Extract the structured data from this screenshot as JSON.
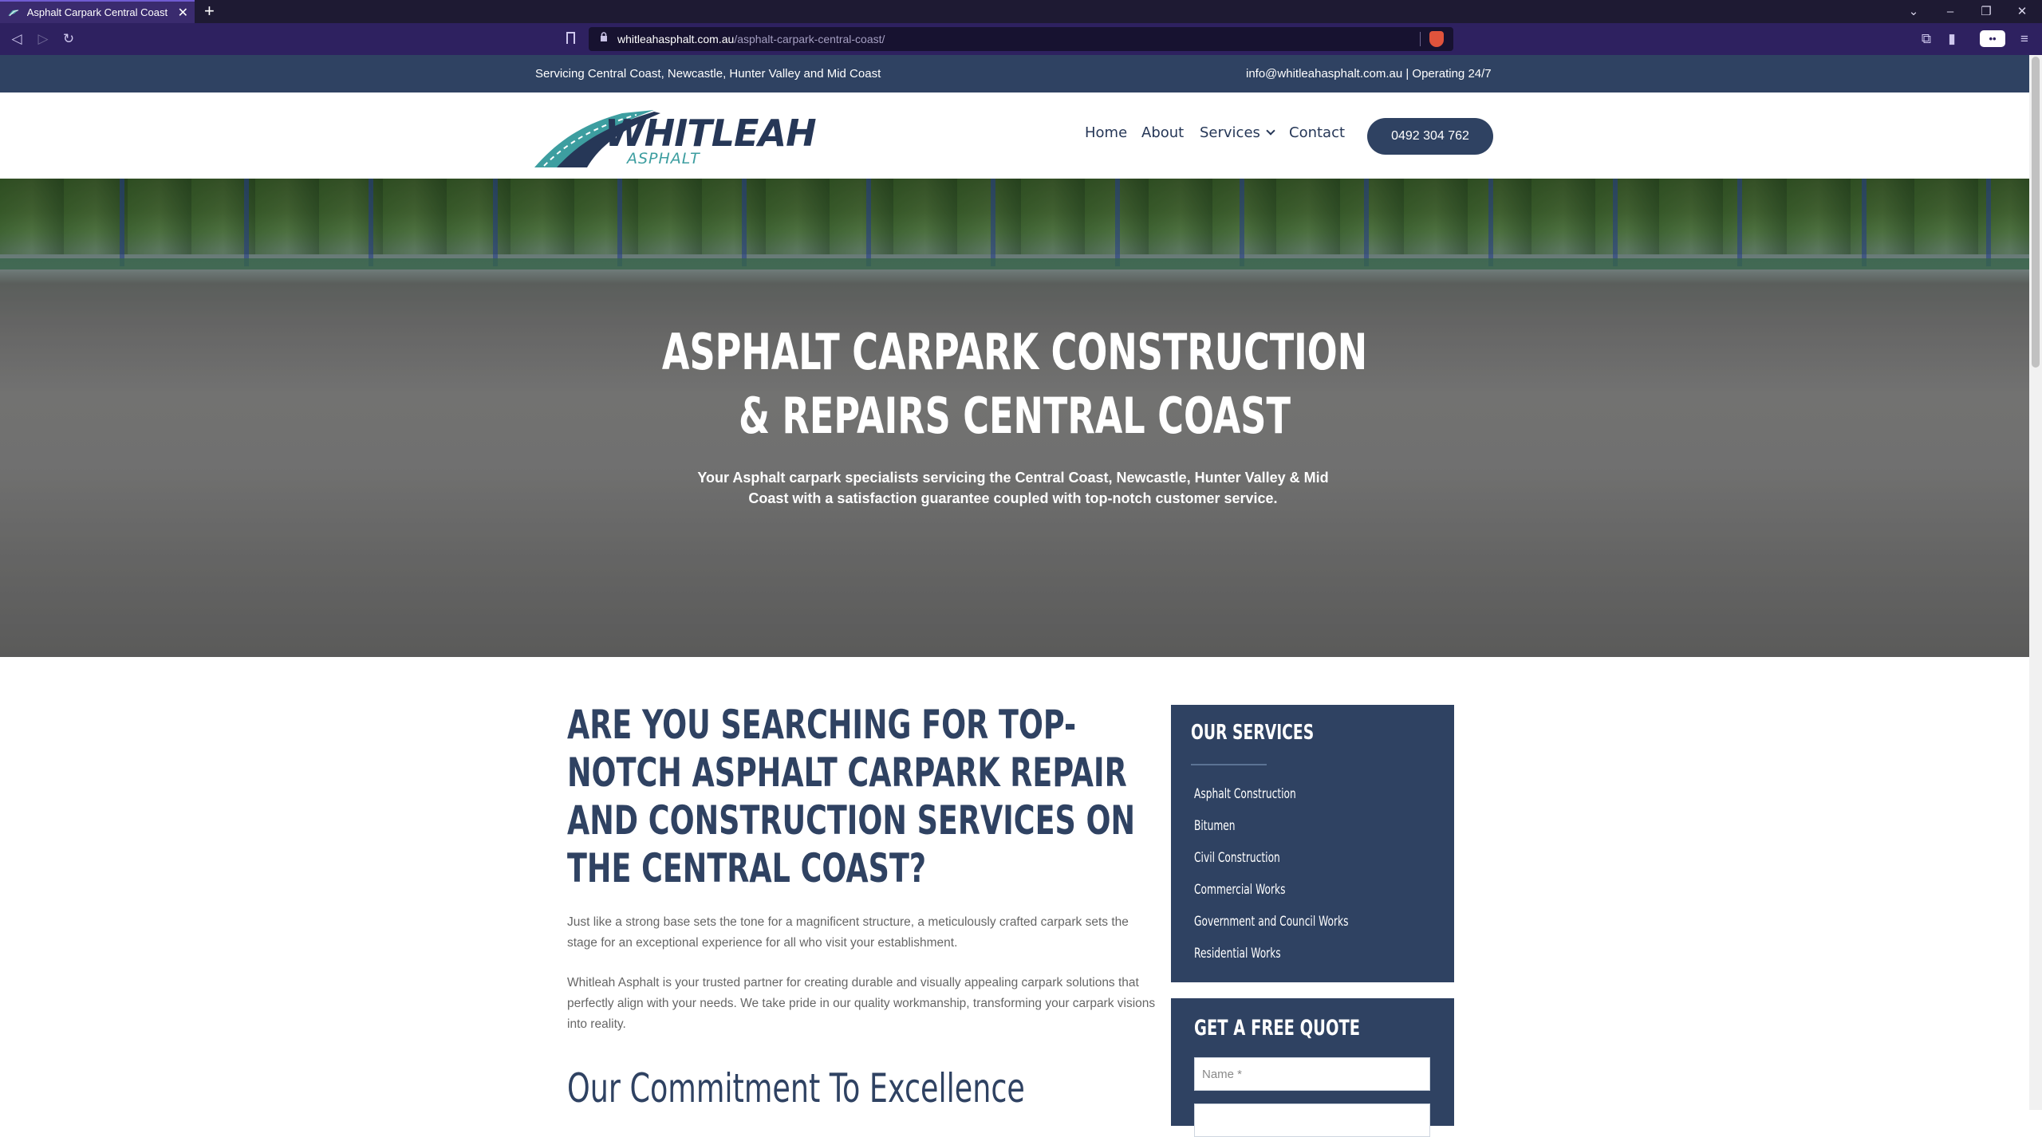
{
  "browser": {
    "tab_title": "Asphalt Carpark Central Coast - W",
    "new_tab": "+",
    "tab_close": "✕",
    "url_host": "whitleahasphalt.com.au",
    "url_path": "/asphalt-carpark-central-coast/",
    "back": "◁",
    "forward": "▷",
    "reload": "↻",
    "lock_icon": "🔒",
    "window_controls": {
      "list": "⌄",
      "minimize": "–",
      "restore": "❐",
      "close": "✕"
    },
    "menu_icon": "≡"
  },
  "topbar": {
    "left": "Servicing Central Coast, Newcastle, Hunter Valley and Mid Coast",
    "right": "info@whitleahasphalt.com.au | Operating 24/7"
  },
  "logo": {
    "word": "WHITLEAH",
    "sub": "ASPHALT"
  },
  "nav": {
    "home": "Home",
    "about": "About",
    "services": "Services",
    "contact": "Contact",
    "phone": "0492 304 762"
  },
  "hero": {
    "title_line1": "ASPHALT CARPARK CONSTRUCTION",
    "title_line2": "& REPAIRS CENTRAL COAST",
    "subtitle": "Your Asphalt carpark specialists servicing the Central Coast, Newcastle, Hunter Valley & Mid Coast with a satisfaction guarantee coupled with top-notch customer service."
  },
  "main": {
    "heading": "ARE YOU SEARCHING FOR TOP-NOTCH ASPHALT CARPARK REPAIR AND CONSTRUCTION SERVICES ON THE CENTRAL COAST?",
    "para1": "Just like a strong base sets the tone for a magnificent structure, a meticulously crafted carpark sets the stage for an exceptional experience for all who visit your establishment.",
    "para2": "Whitleah Asphalt is your trusted partner for creating durable and visually appealing carpark solutions that perfectly align with your needs. We take pride in our quality workmanship, transforming your carpark visions into reality.",
    "subheading": "Our Commitment To Excellence"
  },
  "sidebar": {
    "services_title": "OUR SERVICES",
    "services": [
      "Asphalt Construction",
      "Bitumen",
      "Civil Construction",
      "Commercial Works",
      "Government and Council Works",
      "Residential Works"
    ],
    "quote_title": "GET A FREE QUOTE",
    "name_placeholder": "Name *"
  },
  "colors": {
    "brand_navy": "#2f4262",
    "brand_teal": "#3d9ea0",
    "browser_purple": "#2e2160"
  }
}
